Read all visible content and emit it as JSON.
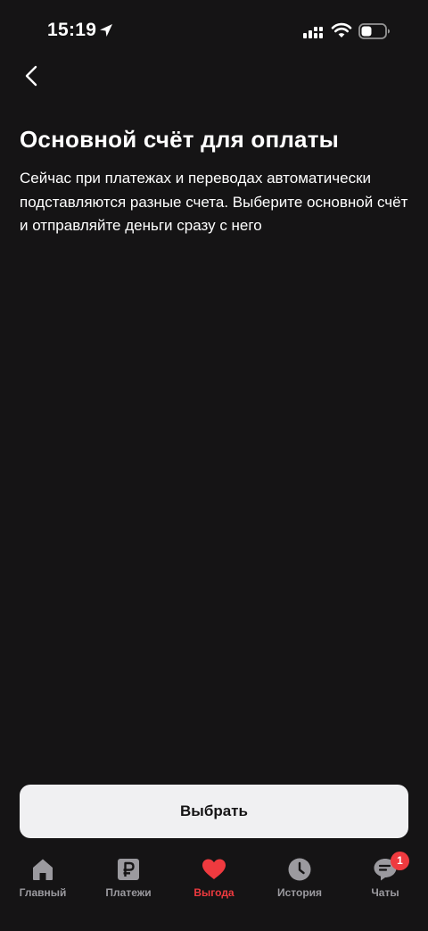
{
  "status_bar": {
    "time": "15:19"
  },
  "page": {
    "back_icon": "chevron-left-icon",
    "title": "Основной счёт для оплаты",
    "description": "Сейчас при платежах и переводах автоматически подставляются разные счета. Выберите основной счёт и отправляйте деньги сразу с него"
  },
  "action": {
    "label": "Выбрать"
  },
  "tab_bar": {
    "tabs": [
      {
        "label": "Главный",
        "icon": "home-icon",
        "active": false
      },
      {
        "label": "Платежи",
        "icon": "ruble-icon",
        "active": false
      },
      {
        "label": "Выгода",
        "icon": "heart-icon",
        "active": true
      },
      {
        "label": "История",
        "icon": "clock-icon",
        "active": false
      },
      {
        "label": "Чаты",
        "icon": "chat-icon",
        "active": false,
        "badge": "1"
      }
    ]
  },
  "colors": {
    "background": "#151415",
    "accent": "#ef3a3f",
    "inactive": "#9b9a9f",
    "button_bg": "#f0f0f2"
  }
}
